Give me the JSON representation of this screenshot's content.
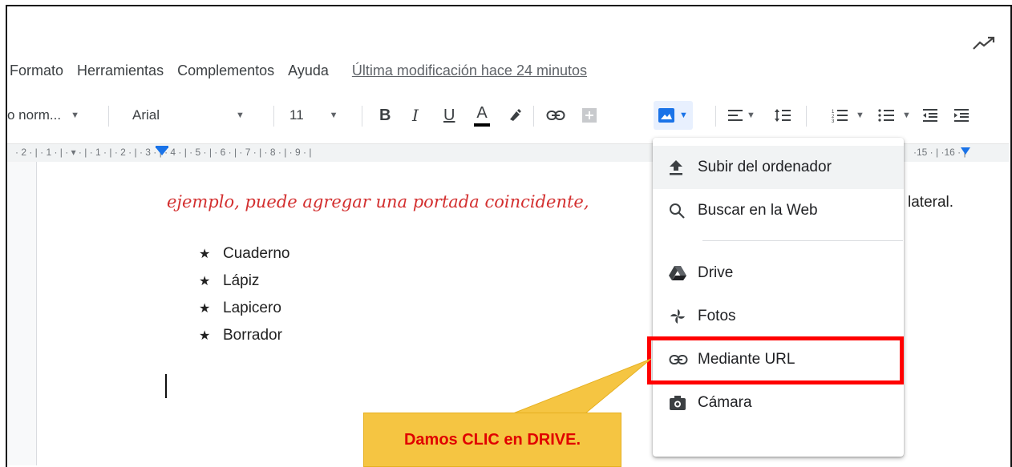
{
  "menubar": {
    "items": [
      "Formato",
      "Herramientas",
      "Complementos",
      "Ayuda"
    ],
    "last_edit": "Última modificación hace 24 minutos"
  },
  "toolbar": {
    "style_select": "o norm...",
    "font_select": "Arial",
    "size_select": "11",
    "bold": "B",
    "italic": "I",
    "underline": "U",
    "text_color": "A"
  },
  "ruler": {
    "numbers": "· 2 · | · 1 · | · ▾ · | · 1 · | · 2 · | · 3 · | · 4 · | · 5 · | · 6 · | · 7 · | · 8 · | · 9 · |",
    "right_numbers": "·15 · | ·16 · |"
  },
  "document": {
    "red_text": "ejemplo, puede agregar una portada coincidente,",
    "lateral": "lateral.",
    "list": [
      "Cuaderno",
      "Lápiz",
      "Lapicero",
      "Borrador"
    ],
    "bullet": "★"
  },
  "image_menu": {
    "items": [
      {
        "label": "Subir del ordenador",
        "icon": "upload-icon"
      },
      {
        "label": "Buscar en la Web",
        "icon": "search-icon"
      },
      {
        "label": "Drive",
        "icon": "drive-icon"
      },
      {
        "label": "Fotos",
        "icon": "photos-icon"
      },
      {
        "label": "Mediante URL",
        "icon": "link-icon"
      },
      {
        "label": "Cámara",
        "icon": "camera-icon"
      }
    ]
  },
  "callout": {
    "text": "Damos CLIC en DRIVE."
  },
  "colors": {
    "highlight_box": "#ff0000",
    "callout_bg": "#f5c542",
    "callout_text": "#e00000",
    "accent_blue": "#1a73e8"
  }
}
